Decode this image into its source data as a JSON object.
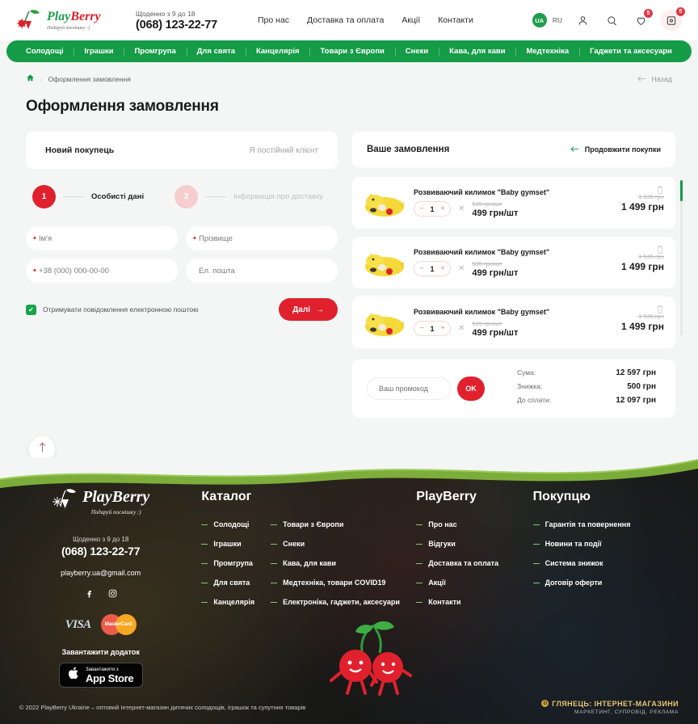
{
  "header": {
    "logo_text_play": "Play",
    "logo_text_berry": "Berry",
    "logo_tagline": "Подаруй посмішку :)",
    "hours_label": "Щоденно з 9 до 18",
    "phone": "(068) 123-22-77",
    "nav": [
      {
        "label": "Про нас"
      },
      {
        "label": "Доставка та оплата"
      },
      {
        "label": "Акції"
      },
      {
        "label": "Контакти"
      }
    ],
    "lang_active": "UA",
    "lang_other": "RU",
    "wishlist_count": "5",
    "cart_count": "5"
  },
  "categories": [
    {
      "label": "Солодощі"
    },
    {
      "label": "Іграшки"
    },
    {
      "label": "Промгрупа"
    },
    {
      "label": "Для свята"
    },
    {
      "label": "Канцелярія"
    },
    {
      "label": "Товари з Європи"
    },
    {
      "label": "Снеки"
    },
    {
      "label": "Кава, для кави"
    },
    {
      "label": "Медтехніка"
    },
    {
      "label": "Гаджети та аксесуари"
    }
  ],
  "breadcrumb": {
    "home_icon": "home-icon",
    "separator": "›",
    "current": "Оформлення замовлення",
    "back_label": "Назад"
  },
  "page_title": "Оформлення замовлення",
  "checkout": {
    "tab_new": "Новий покупець",
    "tab_returning": "Я постійний клієнт",
    "steps": [
      {
        "num": "1",
        "label": "Особисті дані",
        "active": true
      },
      {
        "num": "2",
        "label": "Інформація про доставку",
        "active": false
      }
    ],
    "fields": {
      "first_name_placeholder": "Ім'я",
      "first_name_value": "",
      "last_name_placeholder": "Прізвище",
      "last_name_value": "",
      "phone_placeholder": "+38 (000) 000-00-00",
      "phone_value": "",
      "email_placeholder": "Ел. пошта",
      "email_value": ""
    },
    "checkbox_label": "Отримувати повідомлення електронною поштою",
    "checkbox_mark": "✔",
    "next_button": "Далі",
    "next_arrow": "→"
  },
  "order": {
    "title": "Ваше замовлення",
    "continue_label": "Продовжити покупки",
    "continue_arrow": "←",
    "items": [
      {
        "name": "Розвиваючий килимок \"Baby gymset\"",
        "qty": "1",
        "minus": "−",
        "plus": "+",
        "times": "✕",
        "unit_price_old": "535 грн/шт",
        "unit_price_new": "499 грн/шт",
        "total_old": "1 535 грн",
        "total_new": "1 499 грн",
        "delete_icon": "trash-icon"
      },
      {
        "name": "Розвиваючий килимок \"Baby gymset\"",
        "qty": "1",
        "minus": "−",
        "plus": "+",
        "times": "✕",
        "unit_price_old": "535 грн/шт",
        "unit_price_new": "499 грн/шт",
        "total_old": "1 535 грн",
        "total_new": "1 499 грн",
        "delete_icon": "trash-icon"
      },
      {
        "name": "Розвиваючий килимок \"Baby gymset\"",
        "qty": "1",
        "minus": "−",
        "plus": "+",
        "times": "✕",
        "unit_price_old": "535 грн/шт",
        "unit_price_new": "499 грн/шт",
        "total_old": "1 535 грн",
        "total_new": "1 499 грн",
        "delete_icon": "trash-icon"
      }
    ],
    "promo_placeholder": "Ваш промокод",
    "promo_value": "",
    "promo_button": "OK",
    "totals": [
      {
        "label": "Сума:",
        "value": "12 597 грн"
      },
      {
        "label": "Знижка:",
        "value": "500 грн"
      },
      {
        "label": "До сплати:",
        "value": "12 097 грн"
      }
    ]
  },
  "scroll_top_arrow": "↑",
  "footer": {
    "logo_text": "PlayBerry",
    "logo_tagline": "Подаруй посмішку :)",
    "hours": "Щоденно з 9 до 18",
    "phone": "(068) 123-22-77",
    "email": "playberry.ua@gmail.com",
    "social": [
      {
        "name": "facebook-icon",
        "glyph": "f"
      },
      {
        "name": "instagram-icon",
        "glyph": "◎"
      }
    ],
    "pay_visa": "VISA",
    "pay_mastercard": "MasterCard",
    "download_label": "Завантажити додаток",
    "appstore_small": "Завантажити з",
    "appstore_big": "App Store",
    "columns": [
      {
        "title": "Каталог",
        "groups": [
          [
            "Солодощі",
            "Іграшки",
            "Промгрупа",
            "Для свята",
            "Канцелярія"
          ],
          [
            "Товари з Європи",
            "Снеки",
            "Кава, для кави",
            "Медтехніка, товари COVID19",
            "Електроніка, гаджети, аксесуари"
          ]
        ]
      },
      {
        "title": "PlayBerry",
        "groups": [
          [
            "Про нас",
            "Відгуки",
            "Доставка та оплата",
            "Акції",
            "Контакти"
          ]
        ]
      },
      {
        "title": "Покупцю",
        "groups": [
          [
            "Гарантія та повернення",
            "Новини та події",
            "Система знижок",
            "Договір оферти"
          ]
        ]
      }
    ],
    "copyright": "© 2022 PlayBerry Ukraine – оптовий Інтернет-магазин дитячих солодощів, іграшок та супутних товарів",
    "agency_name": "ГЛЯНЕЦЬ: ІНТЕРНЕТ-МАГАЗИНИ",
    "agency_sub": "МАРКЕТИНГ, СУПРОВІД, РЕКЛАМА",
    "agency_mark": "G"
  },
  "colors": {
    "brand_green": "#169b47",
    "brand_red": "#e0212d",
    "page_bg": "#f4f6f5"
  }
}
